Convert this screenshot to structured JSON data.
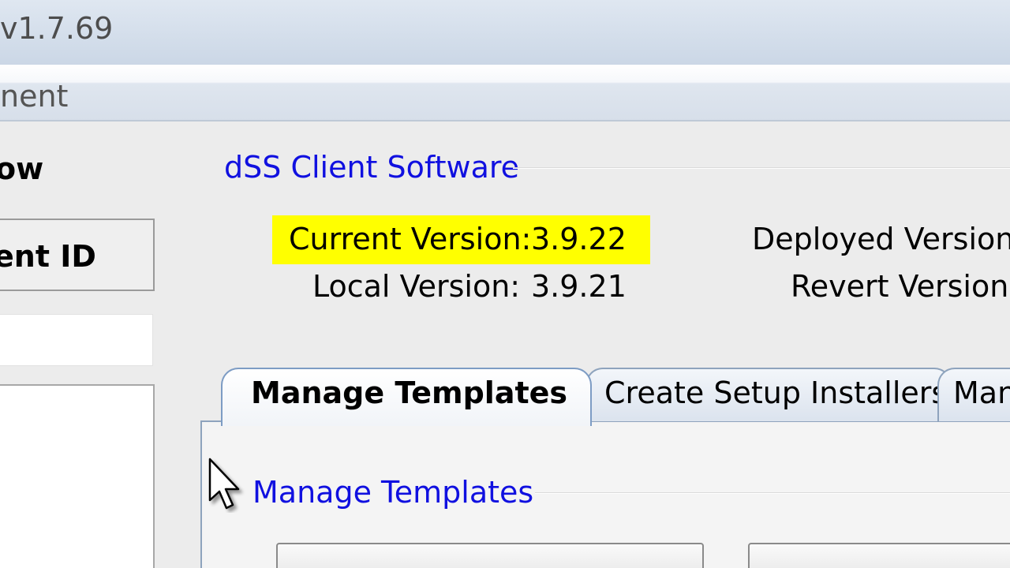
{
  "window": {
    "title_fragment": "v1.7.69",
    "menu_fragment": "nent"
  },
  "left_panel": {
    "heading_fragment": "ow",
    "id_label_fragment": "ent ID"
  },
  "software_group": {
    "title": "dSS Client Software",
    "current_version_label": "Current Version:",
    "current_version_value": "3.9.22",
    "local_version_label": "Local Version:",
    "local_version_value": "3.9.21",
    "deployed_version_label": "Deployed Version:",
    "revert_version_label": "Revert Version:",
    "highlight_color": "#ffff00"
  },
  "tabs": [
    {
      "label": "Manage Templates",
      "active": true
    },
    {
      "label": "Create Setup Installers",
      "active": false
    },
    {
      "label": "Man",
      "active": false
    }
  ],
  "manage_templates_panel": {
    "group_title": "Manage Templates"
  },
  "colors": {
    "link_blue": "#1010e0",
    "tab_border": "#8ea3bd",
    "window_bg": "#ececec"
  }
}
